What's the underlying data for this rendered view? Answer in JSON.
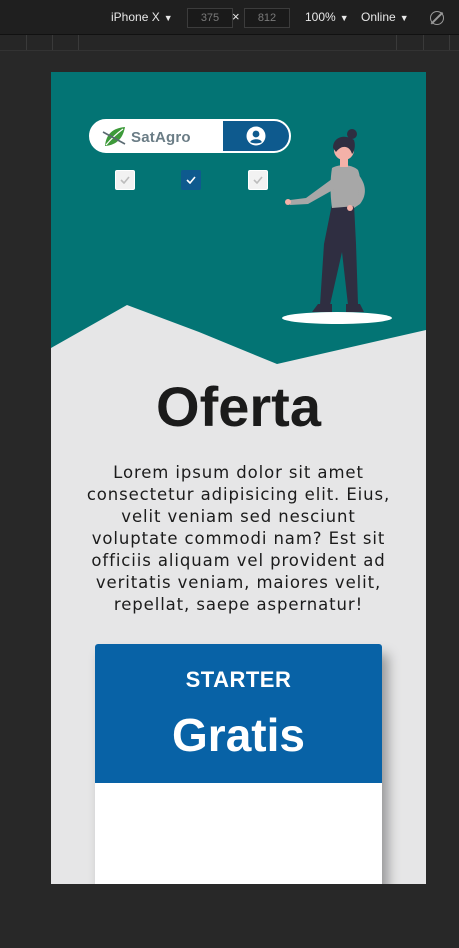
{
  "devtools": {
    "device": "iPhone X",
    "width_value": "375",
    "height_value": "812",
    "zoom": "100%",
    "network": "Online"
  },
  "header": {
    "brand_name": "SatAgro",
    "user_icon": "user-circle-icon",
    "checkbox_states": [
      false,
      true,
      false
    ]
  },
  "content": {
    "title": "Oferta",
    "lead": "Lorem ipsum dolor sit amet consectetur adipisicing elit. Eius, velit veniam sed nesciunt voluptate commodi nam? Est sit officiis aliquam vel provident ad veritatis veniam, maiores velit, repellat, saepe aspernatur!"
  },
  "plan": {
    "name": "STARTER",
    "price": "Gratis"
  },
  "colors": {
    "hero": "#037474",
    "brand_blue": "#0e5a8e",
    "card_header": "#0862a6",
    "page_bg": "#e6e6e7"
  }
}
